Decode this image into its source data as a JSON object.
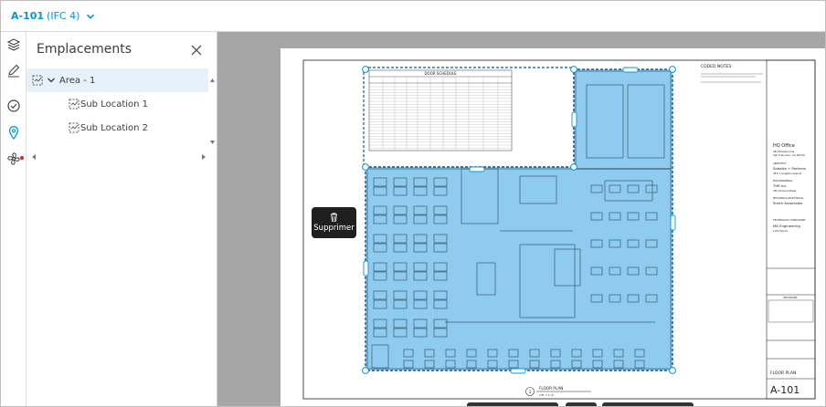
{
  "header": {
    "title": "A-101",
    "version": "(IFC 4)"
  },
  "rail": {
    "icons": [
      "layers-icon",
      "markup-pen-icon",
      "check-circle-icon",
      "location-pin-icon",
      "fan-icon"
    ],
    "active": "location-pin-icon",
    "notification_color": "#e0202a"
  },
  "panel": {
    "title": "Emplacements",
    "tree": [
      {
        "label": "Area - 1",
        "level": 0,
        "expanded": true,
        "selected": true
      },
      {
        "label": "Sub Location 1",
        "level": 1
      },
      {
        "label": "Sub Location 2",
        "level": 1
      }
    ]
  },
  "viewer": {
    "delete_label": "Supprimer",
    "highlight_color": "#8ecbef",
    "accent_color": "#0696d7",
    "sheet": {
      "schedule_title": "DOOR SCHEDULE",
      "notes_title": "CODED NOTES:",
      "project": "HQ Office",
      "address_lines": [
        "48 Address Lane",
        "San Francisco, CA 94118"
      ],
      "architect_label": "ARCHITECT",
      "architect": "Sobotta + Partners",
      "architect_addr": "48 E. Livingston Avenue",
      "consultant1_label": "BUILDING/ENGG.",
      "consultant1": "THR Inc.",
      "consultant1_addr": "250 Channel Street",
      "consultant2_label": "MECHANICAL/ELECTRICAL",
      "consultant2": "Smith Associates",
      "consultant3_label": "TECHNOLOGY CONSULTANT",
      "consultant3": "MA Engineering",
      "consultant3_addr": "1104 Tyle Dr.",
      "revisions_label": "REVISIONS",
      "sheet_title": "FLOOR PLAN",
      "sheet_number": "A-101",
      "drawing_label": "FLOOR PLAN",
      "drawing_number": "1",
      "drawing_scale": "1/8\" = 1'-0\""
    }
  }
}
